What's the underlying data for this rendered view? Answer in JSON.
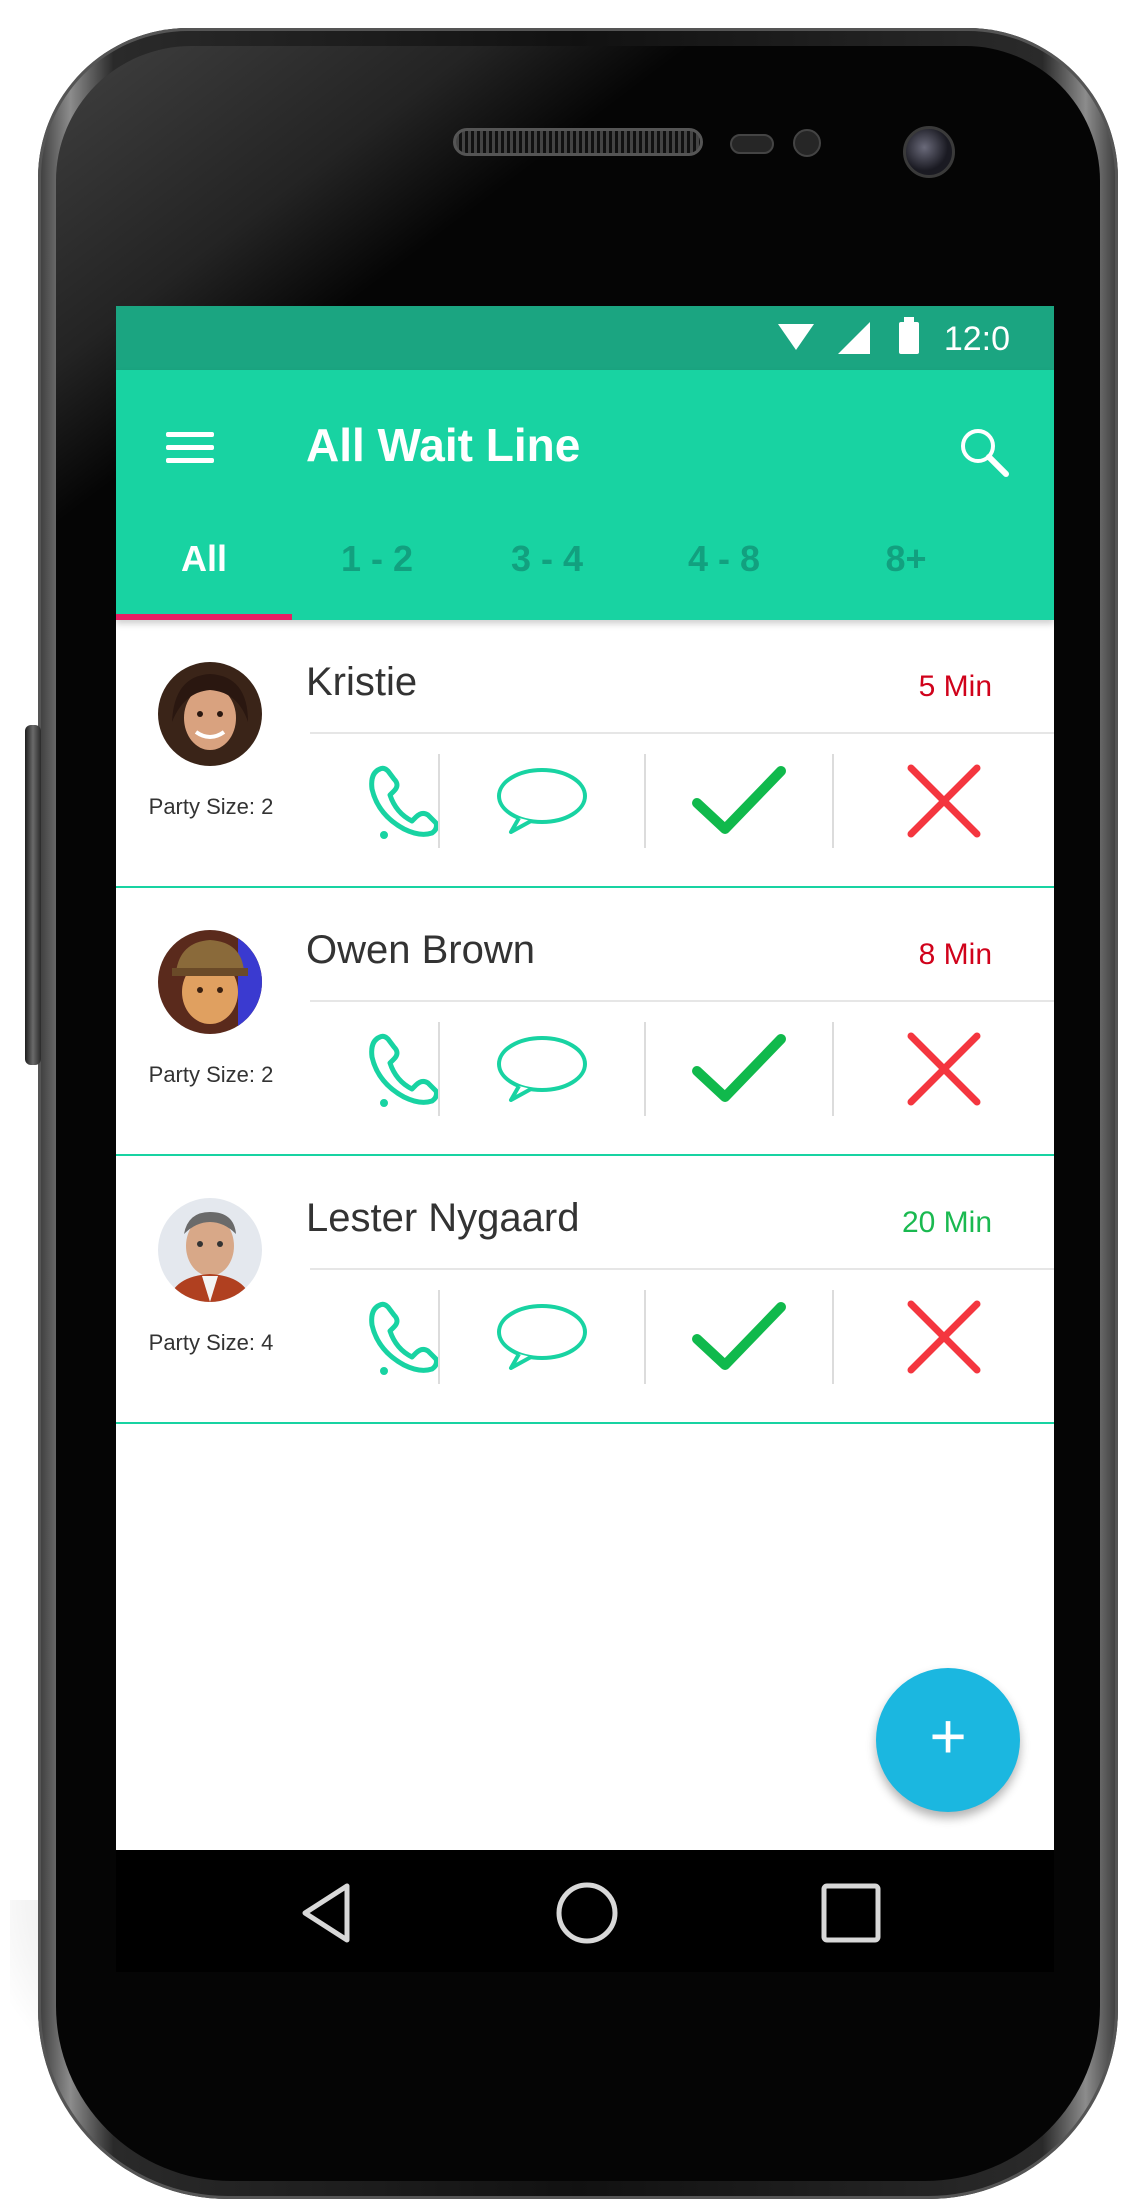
{
  "status_bar": {
    "time": "12:0"
  },
  "app_bar": {
    "title": "All Wait Line"
  },
  "tabs": [
    {
      "label": "All",
      "active": true
    },
    {
      "label": "1 - 2",
      "active": false
    },
    {
      "label": "3 - 4",
      "active": false
    },
    {
      "label": "4 - 8",
      "active": false
    },
    {
      "label": "8+",
      "active": false
    }
  ],
  "guests": [
    {
      "name": "Kristie",
      "party": "Party Size: 2",
      "wait": "5 Min",
      "wait_color": "#d0021b"
    },
    {
      "name": "Owen Brown",
      "party": "Party Size: 2",
      "wait": "8 Min",
      "wait_color": "#d0021b"
    },
    {
      "name": "Lester Nygaard",
      "party": "Party Size: 4",
      "wait": "20 Min",
      "wait_color": "#1ab950"
    }
  ],
  "fab": {
    "label": "+"
  },
  "colors": {
    "accent": "#18d3a2",
    "status_bar": "#1ba581",
    "tab_indicator": "#e91e63",
    "check": "#10b94c",
    "reject": "#f4363f",
    "fab": "#1bb7e0"
  },
  "icons": [
    "menu-icon",
    "search-icon",
    "phone-icon",
    "chat-icon",
    "check-icon",
    "close-icon",
    "back-icon",
    "home-icon",
    "recents-icon",
    "add-icon"
  ]
}
